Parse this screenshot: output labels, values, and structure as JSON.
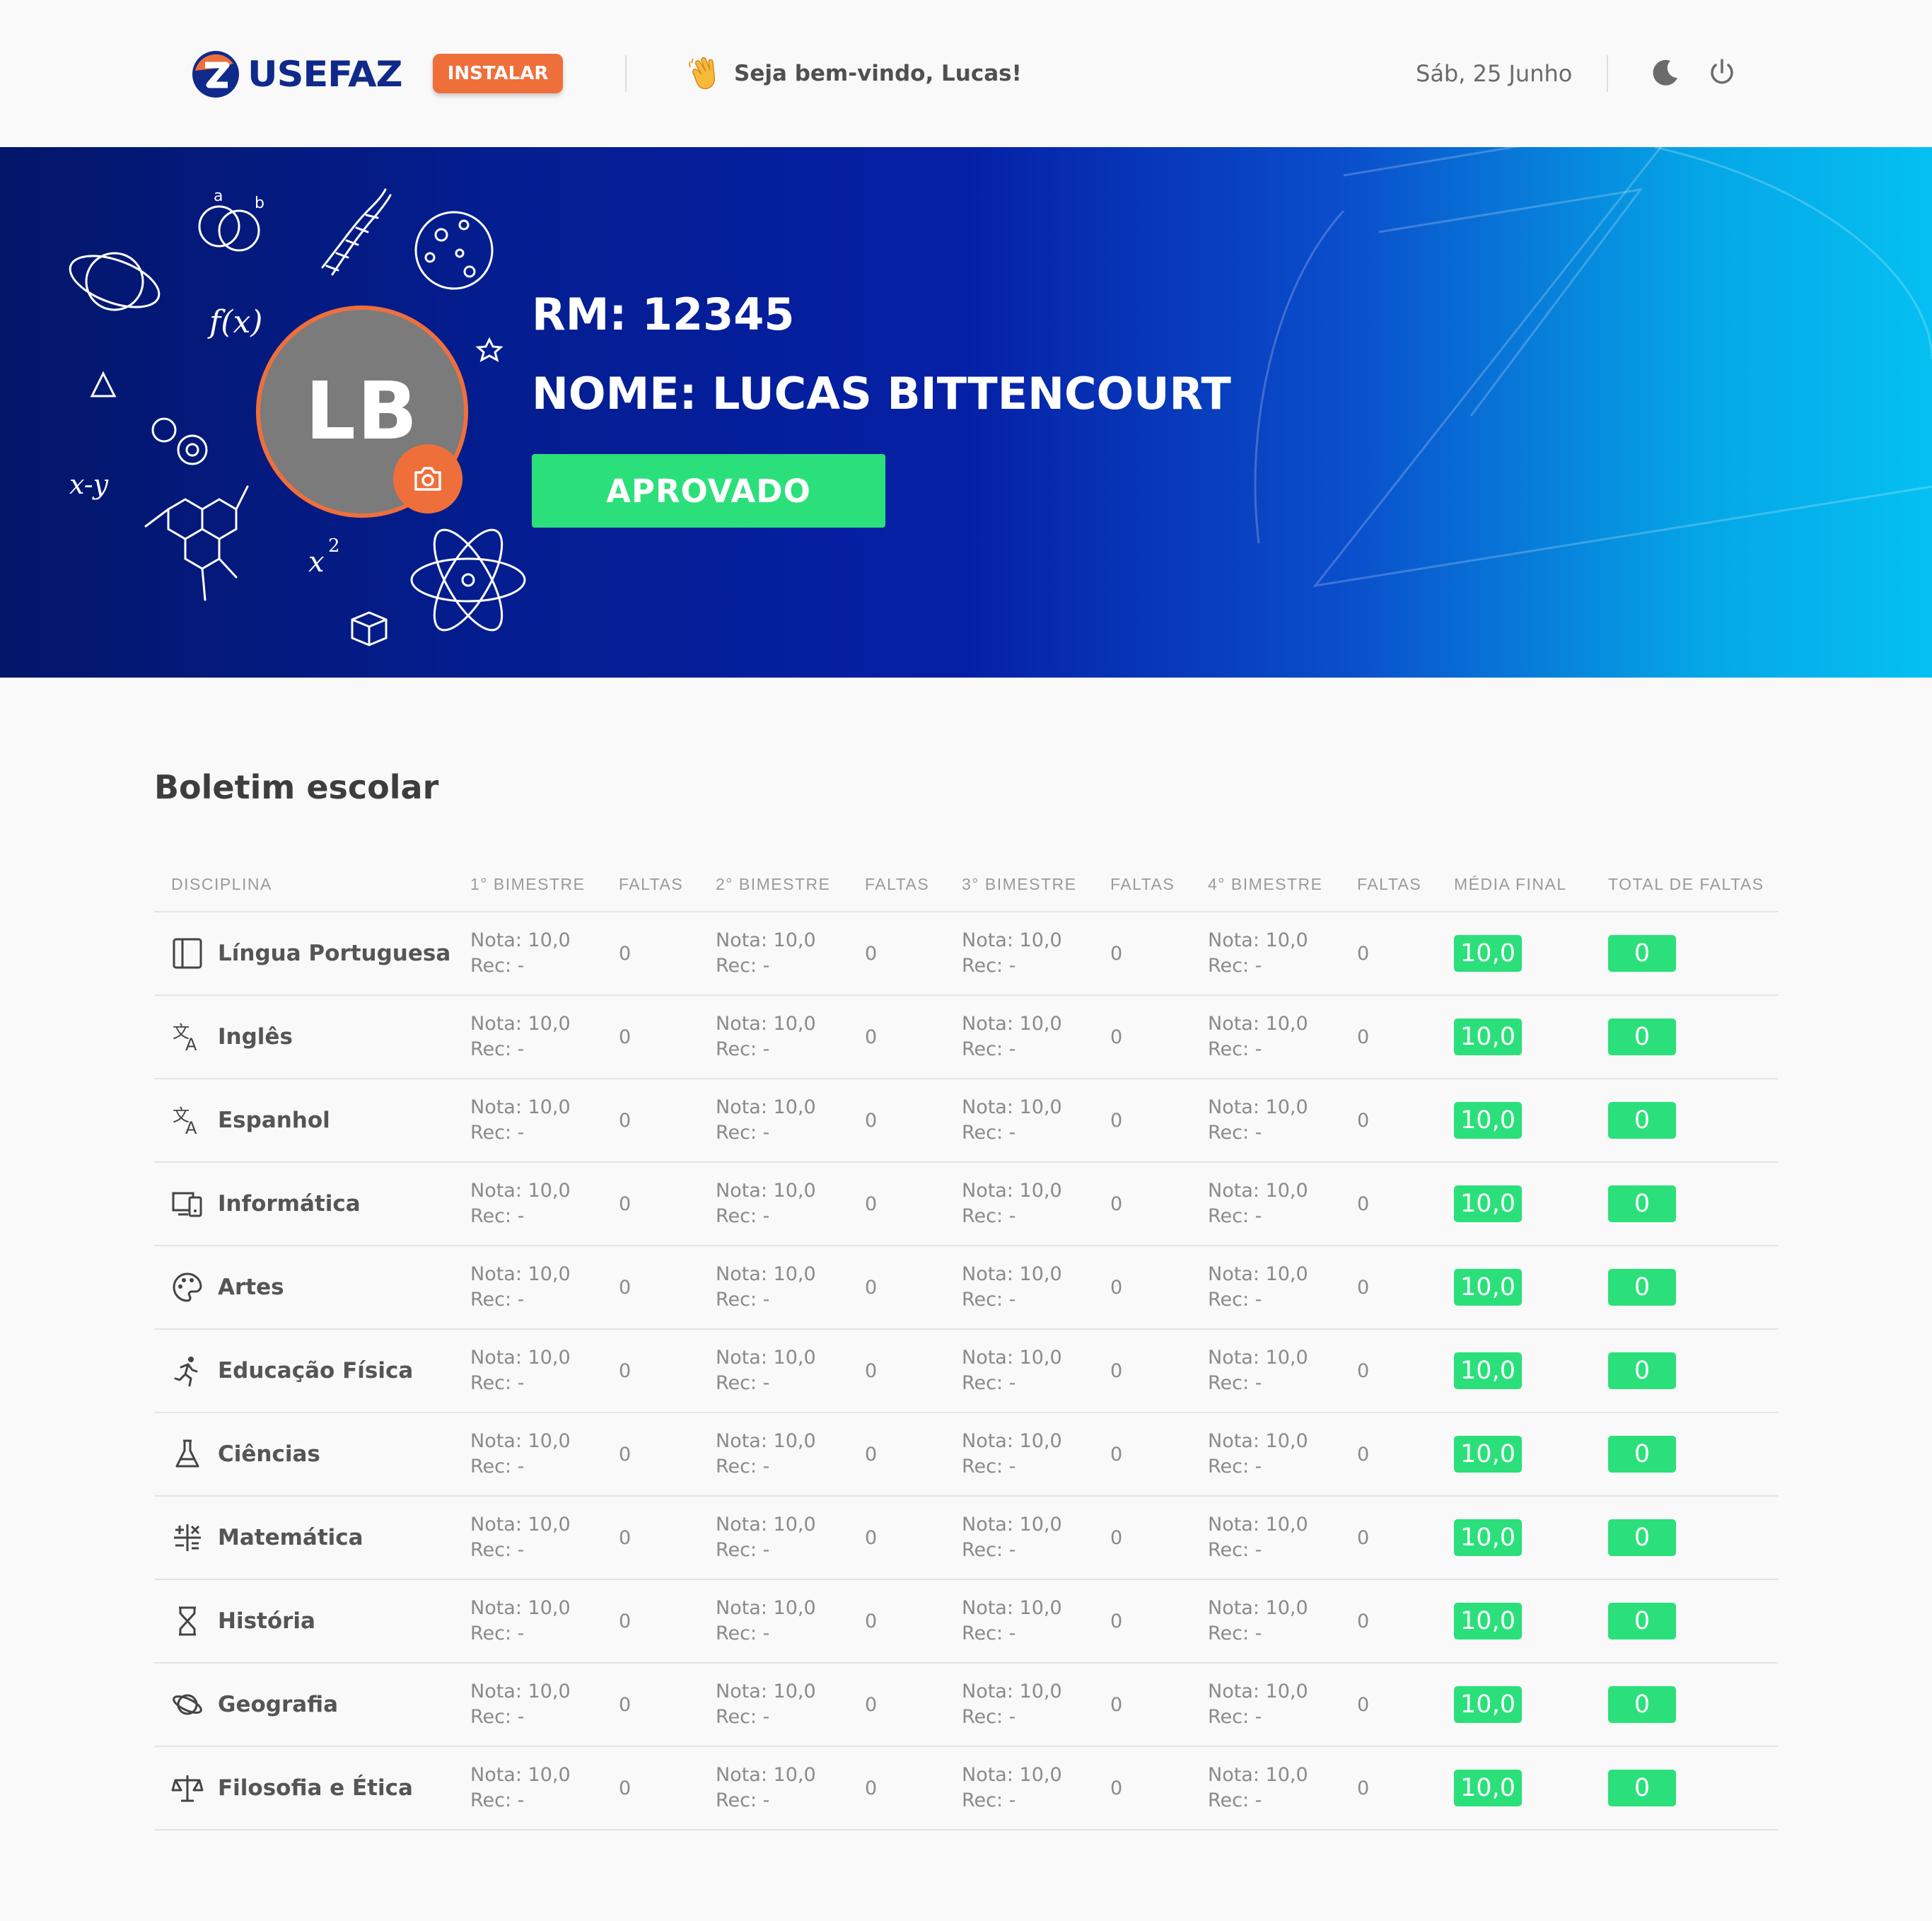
{
  "header": {
    "brand": "USEFAZ",
    "install_label": "INSTALAR",
    "welcome": "Seja bem-vindo, Lucas!",
    "date": "Sáb, 25 Junho",
    "icons": [
      "moon-icon",
      "power-icon"
    ]
  },
  "profile": {
    "initials": "LB",
    "rm": "RM: 12345",
    "nome": "NOME: LUCAS BITTENCOURT",
    "status": "APROVADO"
  },
  "colors": {
    "accent_orange": "#ef6f3b",
    "success_green": "#2be07a",
    "brand_navy": "#0f2a8a"
  },
  "report": {
    "title": "Boletim escolar",
    "columns": [
      "DISCIPLINA",
      "1° BIMESTRE",
      "FALTAS",
      "2° BIMESTRE",
      "FALTAS",
      "3° BIMESTRE",
      "FALTAS",
      "4° BIMESTRE",
      "FALTAS",
      "MÉDIA FINAL",
      "TOTAL DE FALTAS"
    ],
    "rows": [
      {
        "subject": "Língua Portuguesa",
        "icon": "book-icon",
        "b1": {
          "nota": "Nota: 10,0",
          "rec": "Rec: -"
        },
        "f1": "0",
        "b2": {
          "nota": "Nota: 10,0",
          "rec": "Rec: -"
        },
        "f2": "0",
        "b3": {
          "nota": "Nota: 10,0",
          "rec": "Rec: -"
        },
        "f3": "0",
        "b4": {
          "nota": "Nota: 10,0",
          "rec": "Rec: -"
        },
        "f4": "0",
        "media": "10,0",
        "total_faltas": "0"
      },
      {
        "subject": "Inglês",
        "icon": "translate-icon",
        "b1": {
          "nota": "Nota: 10,0",
          "rec": "Rec: -"
        },
        "f1": "0",
        "b2": {
          "nota": "Nota: 10,0",
          "rec": "Rec: -"
        },
        "f2": "0",
        "b3": {
          "nota": "Nota: 10,0",
          "rec": "Rec: -"
        },
        "f3": "0",
        "b4": {
          "nota": "Nota: 10,0",
          "rec": "Rec: -"
        },
        "f4": "0",
        "media": "10,0",
        "total_faltas": "0"
      },
      {
        "subject": "Espanhol",
        "icon": "translate-icon",
        "b1": {
          "nota": "Nota: 10,0",
          "rec": "Rec: -"
        },
        "f1": "0",
        "b2": {
          "nota": "Nota: 10,0",
          "rec": "Rec: -"
        },
        "f2": "0",
        "b3": {
          "nota": "Nota: 10,0",
          "rec": "Rec: -"
        },
        "f3": "0",
        "b4": {
          "nota": "Nota: 10,0",
          "rec": "Rec: -"
        },
        "f4": "0",
        "media": "10,0",
        "total_faltas": "0"
      },
      {
        "subject": "Informática",
        "icon": "devices-icon",
        "b1": {
          "nota": "Nota: 10,0",
          "rec": "Rec: -"
        },
        "f1": "0",
        "b2": {
          "nota": "Nota: 10,0",
          "rec": "Rec: -"
        },
        "f2": "0",
        "b3": {
          "nota": "Nota: 10,0",
          "rec": "Rec: -"
        },
        "f3": "0",
        "b4": {
          "nota": "Nota: 10,0",
          "rec": "Rec: -"
        },
        "f4": "0",
        "media": "10,0",
        "total_faltas": "0"
      },
      {
        "subject": "Artes",
        "icon": "palette-icon",
        "b1": {
          "nota": "Nota: 10,0",
          "rec": "Rec: -"
        },
        "f1": "0",
        "b2": {
          "nota": "Nota: 10,0",
          "rec": "Rec: -"
        },
        "f2": "0",
        "b3": {
          "nota": "Nota: 10,0",
          "rec": "Rec: -"
        },
        "f3": "0",
        "b4": {
          "nota": "Nota: 10,0",
          "rec": "Rec: -"
        },
        "f4": "0",
        "media": "10,0",
        "total_faltas": "0"
      },
      {
        "subject": "Educação Física",
        "icon": "running-icon",
        "b1": {
          "nota": "Nota: 10,0",
          "rec": "Rec: -"
        },
        "f1": "0",
        "b2": {
          "nota": "Nota: 10,0",
          "rec": "Rec: -"
        },
        "f2": "0",
        "b3": {
          "nota": "Nota: 10,0",
          "rec": "Rec: -"
        },
        "f3": "0",
        "b4": {
          "nota": "Nota: 10,0",
          "rec": "Rec: -"
        },
        "f4": "0",
        "media": "10,0",
        "total_faltas": "0"
      },
      {
        "subject": "Ciências",
        "icon": "flask-icon",
        "b1": {
          "nota": "Nota: 10,0",
          "rec": "Rec: -"
        },
        "f1": "0",
        "b2": {
          "nota": "Nota: 10,0",
          "rec": "Rec: -"
        },
        "f2": "0",
        "b3": {
          "nota": "Nota: 10,0",
          "rec": "Rec: -"
        },
        "f3": "0",
        "b4": {
          "nota": "Nota: 10,0",
          "rec": "Rec: -"
        },
        "f4": "0",
        "media": "10,0",
        "total_faltas": "0"
      },
      {
        "subject": "Matemática",
        "icon": "calculate-icon",
        "b1": {
          "nota": "Nota: 10,0",
          "rec": "Rec: -"
        },
        "f1": "0",
        "b2": {
          "nota": "Nota: 10,0",
          "rec": "Rec: -"
        },
        "f2": "0",
        "b3": {
          "nota": "Nota: 10,0",
          "rec": "Rec: -"
        },
        "f3": "0",
        "b4": {
          "nota": "Nota: 10,0",
          "rec": "Rec: -"
        },
        "f4": "0",
        "media": "10,0",
        "total_faltas": "0"
      },
      {
        "subject": "História",
        "icon": "hourglass-icon",
        "b1": {
          "nota": "Nota: 10,0",
          "rec": "Rec: -"
        },
        "f1": "0",
        "b2": {
          "nota": "Nota: 10,0",
          "rec": "Rec: -"
        },
        "f2": "0",
        "b3": {
          "nota": "Nota: 10,0",
          "rec": "Rec: -"
        },
        "f3": "0",
        "b4": {
          "nota": "Nota: 10,0",
          "rec": "Rec: -"
        },
        "f4": "0",
        "media": "10,0",
        "total_faltas": "0"
      },
      {
        "subject": "Geografia",
        "icon": "planet-icon",
        "b1": {
          "nota": "Nota: 10,0",
          "rec": "Rec: -"
        },
        "f1": "0",
        "b2": {
          "nota": "Nota: 10,0",
          "rec": "Rec: -"
        },
        "f2": "0",
        "b3": {
          "nota": "Nota: 10,0",
          "rec": "Rec: -"
        },
        "f3": "0",
        "b4": {
          "nota": "Nota: 10,0",
          "rec": "Rec: -"
        },
        "f4": "0",
        "media": "10,0",
        "total_faltas": "0"
      },
      {
        "subject": "Filosofia e Ética",
        "icon": "scale-icon",
        "b1": {
          "nota": "Nota: 10,0",
          "rec": "Rec: -"
        },
        "f1": "0",
        "b2": {
          "nota": "Nota: 10,0",
          "rec": "Rec: -"
        },
        "f2": "0",
        "b3": {
          "nota": "Nota: 10,0",
          "rec": "Rec: -"
        },
        "f3": "0",
        "b4": {
          "nota": "Nota: 10,0",
          "rec": "Rec: -"
        },
        "f4": "0",
        "media": "10,0",
        "total_faltas": "0"
      }
    ]
  }
}
